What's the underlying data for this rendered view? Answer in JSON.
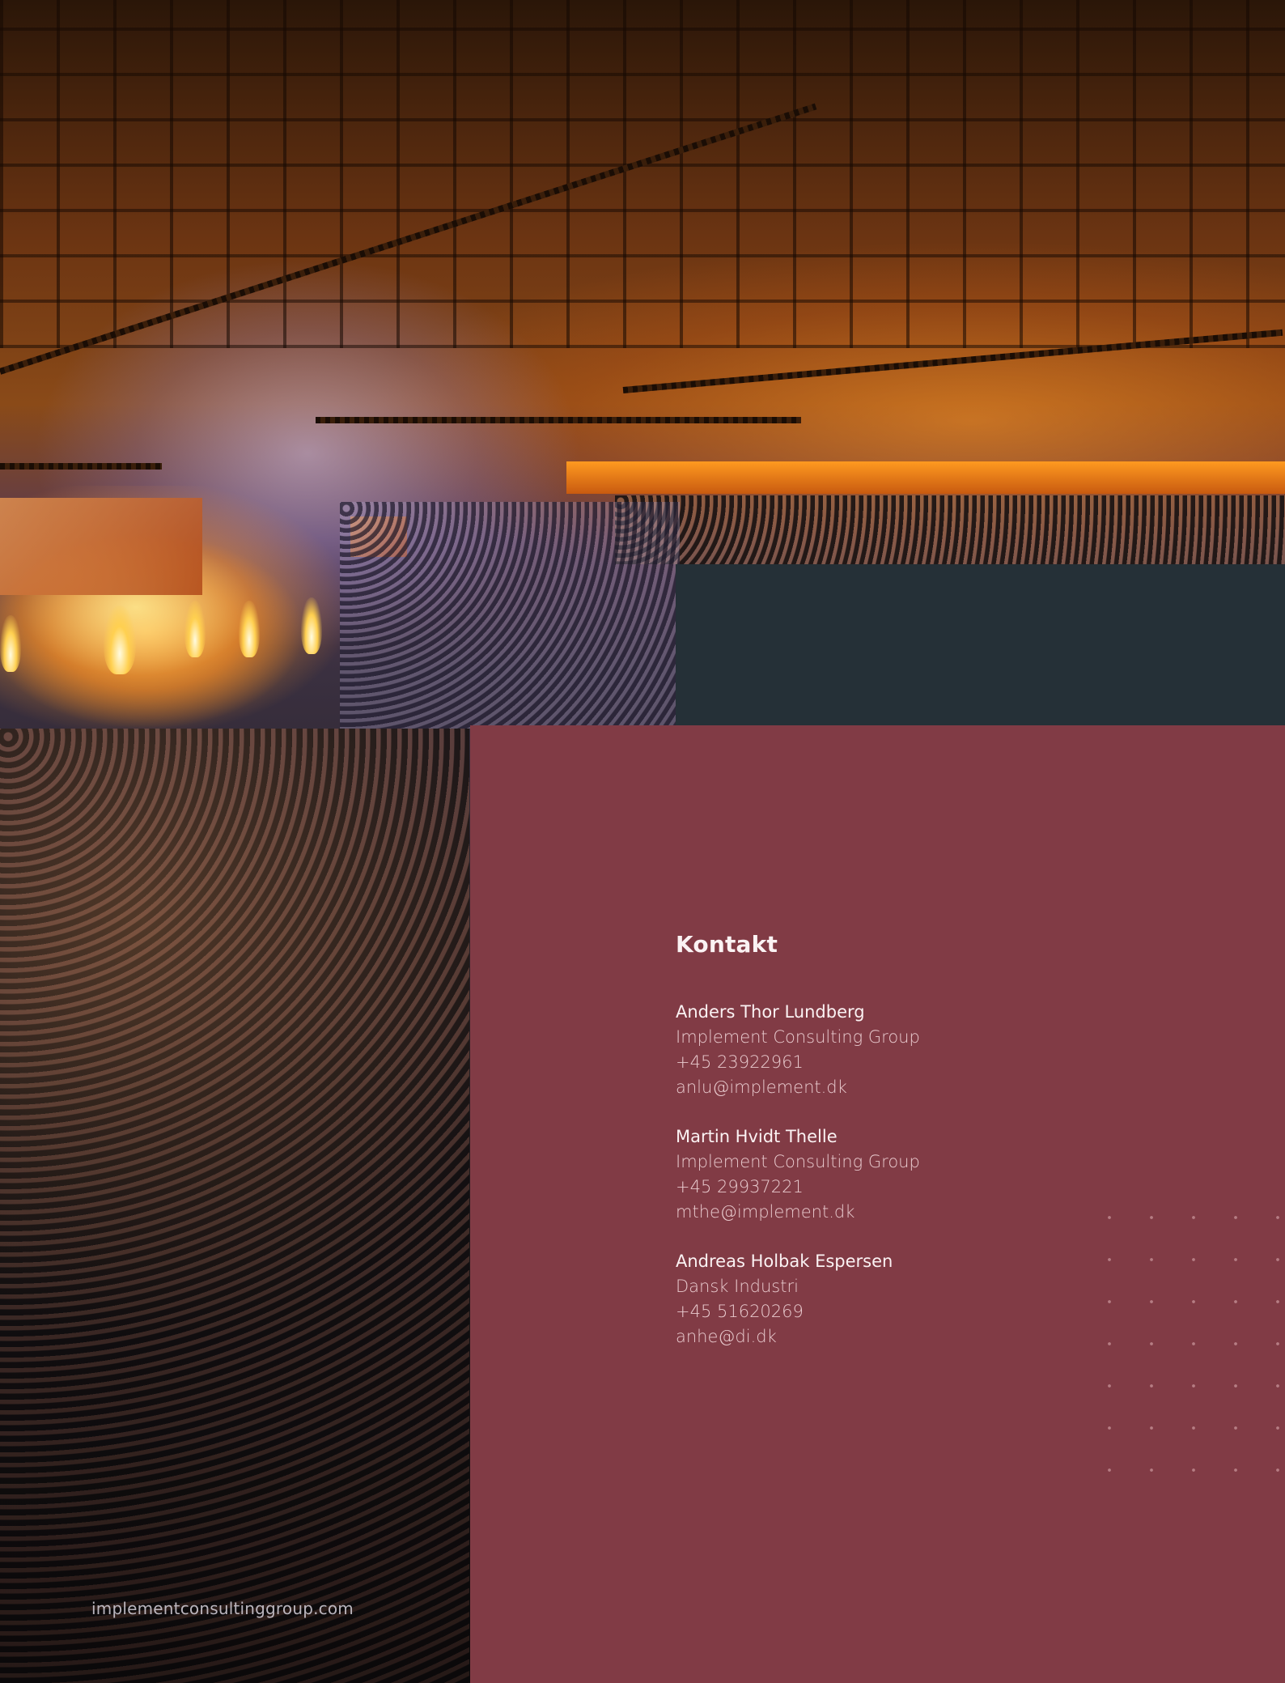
{
  "contact": {
    "heading": "Kontakt",
    "people": [
      {
        "name": "Anders Thor Lundberg",
        "company": "Implement Consulting Group",
        "phone": "+45 23922961",
        "email": "anlu@implement.dk"
      },
      {
        "name": "Martin Hvidt Thelle",
        "company": "Implement Consulting Group",
        "phone": "+45 29937221",
        "email": "mthe@implement.dk"
      },
      {
        "name": "Andreas Holbak Espersen",
        "company": "Dansk Industri",
        "phone": "+45 51620269",
        "email": "anhe@di.dk"
      }
    ]
  },
  "footer": {
    "url": "implementconsultinggroup.com"
  },
  "colors": {
    "maroon_panel": "#813b45",
    "dark_panel": "#253037",
    "text_light": "#fbf2f3"
  }
}
